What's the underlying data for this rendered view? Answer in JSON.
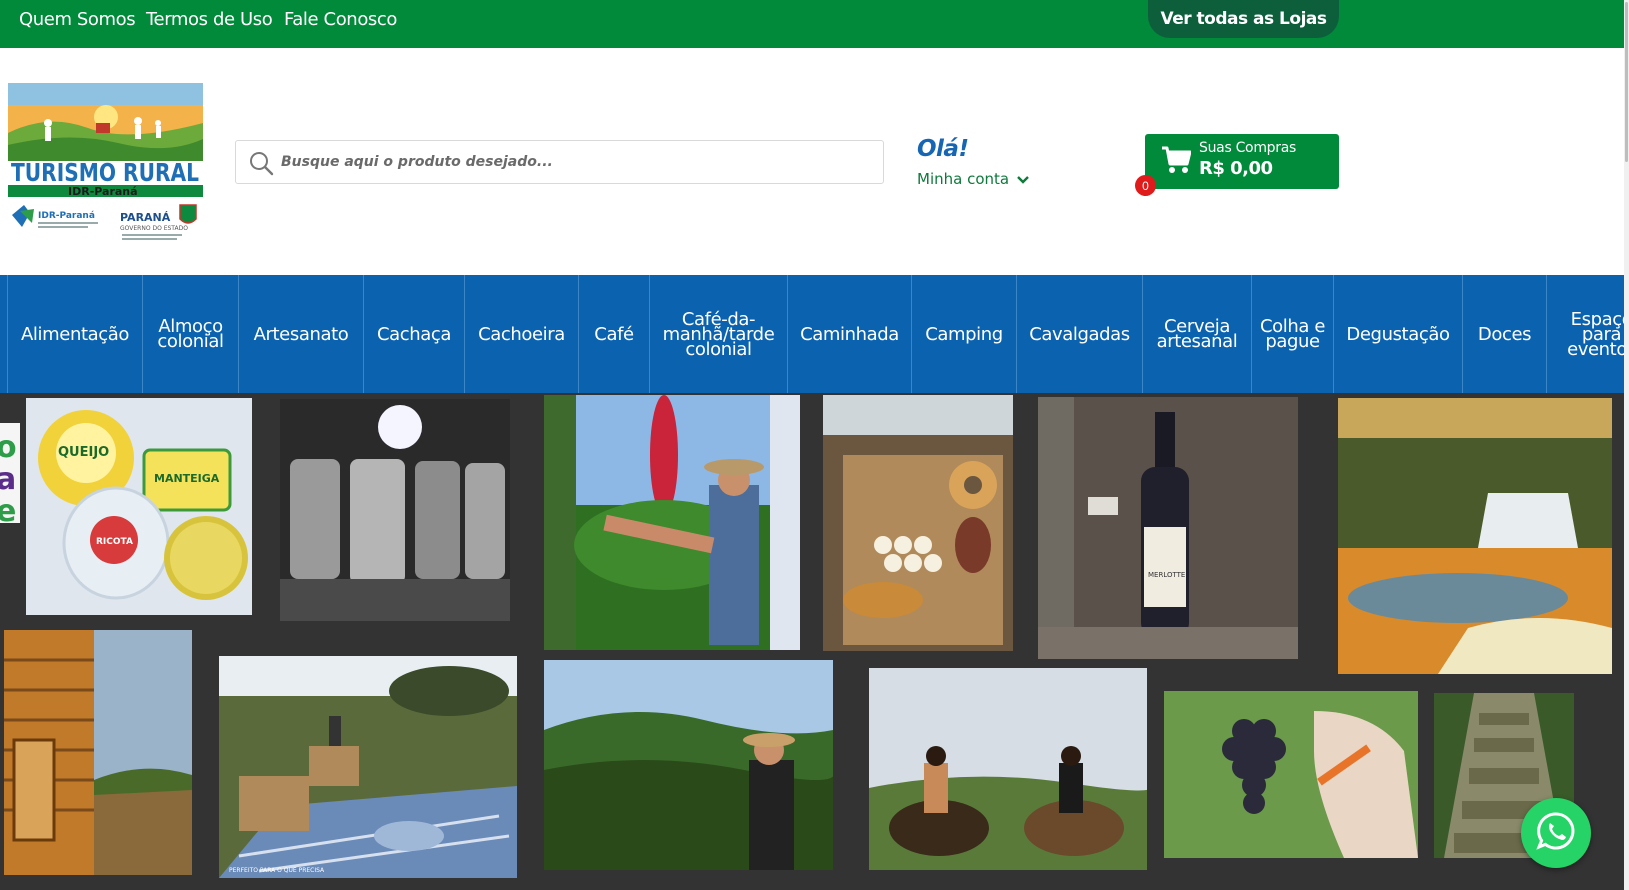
{
  "topbar": {
    "links": [
      "Quem Somos",
      "Termos de Uso",
      "Fale Conosco"
    ],
    "all_stores_label": "Ver todas as Lojas"
  },
  "logo": {
    "title": "TURISMO RURAL",
    "subtitle": "IDR-Paraná",
    "partner_left": "IDR-Paraná",
    "partner_right": "PARANÁ",
    "partner_right_sub": "GOVERNO DO ESTADO"
  },
  "search": {
    "placeholder": "Busque aqui o produto desejado..."
  },
  "account": {
    "greeting": "Olá!",
    "label": "Minha conta"
  },
  "cart": {
    "label": "Suas Compras",
    "total": "R$ 0,00",
    "count": "0"
  },
  "categories": [
    "Alimentação",
    "Almoço colonial",
    "Artesanato",
    "Cachaça",
    "Cachoeira",
    "Café",
    "Café-da-manhã/tarde colonial",
    "Caminhada",
    "Camping",
    "Cavalgadas",
    "Cerveja artesanal",
    "Colha e pague",
    "Degustação",
    "Doces",
    "Espaço para eventos"
  ],
  "gallery": {
    "cheese_labels": [
      "QUEIJO",
      "MANTEIGA",
      "RICOTA"
    ],
    "wine_label": "MERLOTTE",
    "picnic_caption": "PERFEITO PARA O QUE PRECISA",
    "edge_letters": [
      "o",
      "a",
      "e"
    ]
  },
  "colors": {
    "topbar_green": "#008a3a",
    "category_blue": "#0b63b0",
    "cart_badge_red": "#e01b1b",
    "whatsapp_green": "#25d366"
  },
  "icons": [
    "search-icon",
    "chevron-down-icon",
    "cart-icon",
    "whatsapp-icon"
  ]
}
